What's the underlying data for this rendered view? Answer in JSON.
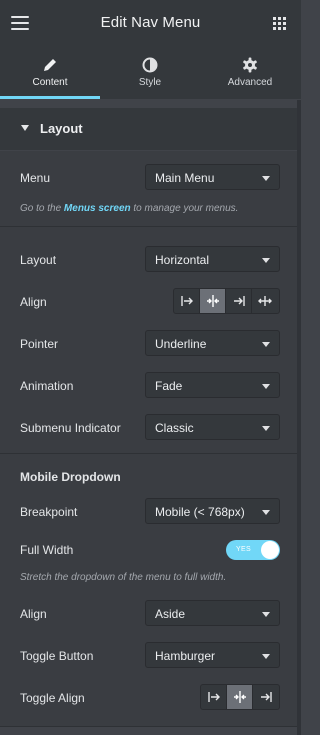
{
  "header": {
    "title": "Edit Nav Menu",
    "menu_icon": "hamburger-icon",
    "apps_icon": "grid-icon"
  },
  "tabs": [
    {
      "label": "Content",
      "icon": "pencil-icon",
      "active": true
    },
    {
      "label": "Style",
      "icon": "half-circle-icon",
      "active": false
    },
    {
      "label": "Advanced",
      "icon": "gear-icon",
      "active": false
    }
  ],
  "section": {
    "title": "Layout"
  },
  "menu": {
    "label": "Menu",
    "value": "Main Menu",
    "note_prefix": "Go to the ",
    "note_link": "Menus screen",
    "note_suffix": " to manage your menus."
  },
  "layout": {
    "label": "Layout",
    "value": "Horizontal"
  },
  "align": {
    "label": "Align",
    "selected_index": 1
  },
  "pointer": {
    "label": "Pointer",
    "value": "Underline"
  },
  "animation": {
    "label": "Animation",
    "value": "Fade"
  },
  "submenu_indicator": {
    "label": "Submenu Indicator",
    "value": "Classic"
  },
  "mobile": {
    "heading": "Mobile Dropdown",
    "breakpoint": {
      "label": "Breakpoint",
      "value": "Mobile (< 768px)"
    },
    "full_width": {
      "label": "Full Width",
      "toggle_text": "YES",
      "on": true,
      "note": "Stretch the dropdown of the menu to full width."
    },
    "align": {
      "label": "Align",
      "value": "Aside"
    },
    "toggle_button": {
      "label": "Toggle Button",
      "value": "Hamburger"
    },
    "toggle_align": {
      "label": "Toggle Align",
      "selected_index": 1
    }
  },
  "colors": {
    "accent": "#71d7f7",
    "panel": "#3a3d42",
    "header": "#34383c"
  }
}
